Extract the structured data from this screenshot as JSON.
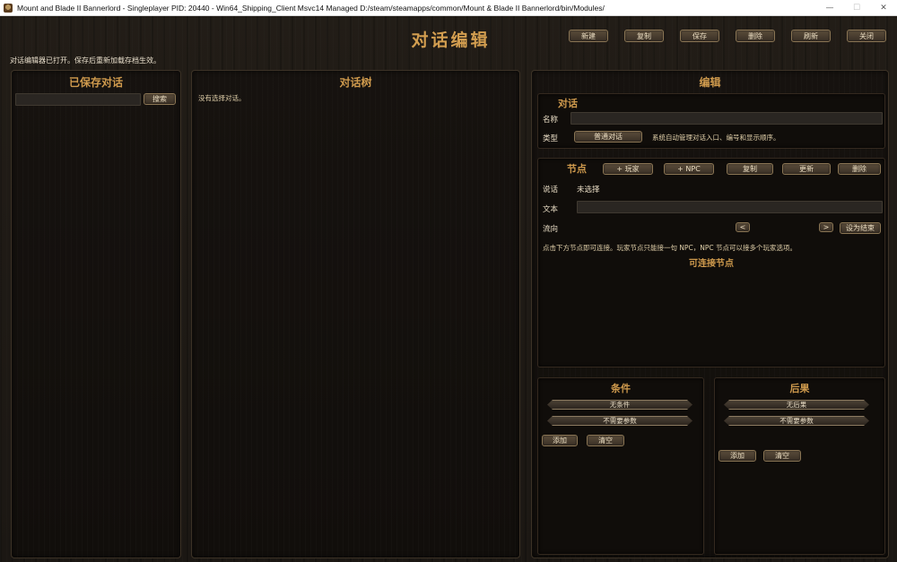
{
  "window": {
    "title": "Mount and Blade II Bannerlord - Singleplayer PID: 20440 -  Win64_Shipping_Client Msvc14 Managed D:/steam/steamapps/common/Mount & Blade II Bannerlord/bin/Modules/",
    "controls": [
      "—",
      "☐",
      "✕"
    ]
  },
  "header": {
    "title": "对话编辑",
    "buttons": [
      "新建",
      "复制",
      "保存",
      "删除",
      "刷新",
      "关闭"
    ],
    "status": "对话编辑器已打开。保存后重新加载存档生效。"
  },
  "saved_panel": {
    "heading": "已保存对话",
    "search_value": "",
    "search_button": "搜索"
  },
  "tree_panel": {
    "heading": "对话树",
    "empty_text": "没有选择对话。"
  },
  "edit_panel": {
    "heading": "编辑",
    "dialogue": {
      "title": "对话",
      "name_label": "名称",
      "name_value": "",
      "type_label": "类型",
      "type_value": "普通对话",
      "type_hint": "系统自动管理对话入口、编号和显示顺序。"
    },
    "node": {
      "title": "节点",
      "buttons": [
        "+ 玩家",
        "+ NPC",
        "复制",
        "更新",
        "删除"
      ],
      "speaker_label": "说话",
      "speaker_value": "未选择",
      "text_label": "文本",
      "text_value": "",
      "flow_label": "流向",
      "prev": "<",
      "next": ">",
      "set_end": "设为结束",
      "help": "点击下方节点即可连接。玩家节点只能接一句 NPC，NPC 节点可以接多个玩家选项。",
      "connectable_title": "可连接节点"
    },
    "conditions": {
      "title": "条件",
      "selected": "无条件",
      "param": "不需要参数",
      "add": "添加",
      "clear": "清空"
    },
    "consequences": {
      "title": "后果",
      "selected": "无后果",
      "param": "不需要参数",
      "add": "添加",
      "clear": "清空"
    }
  }
}
